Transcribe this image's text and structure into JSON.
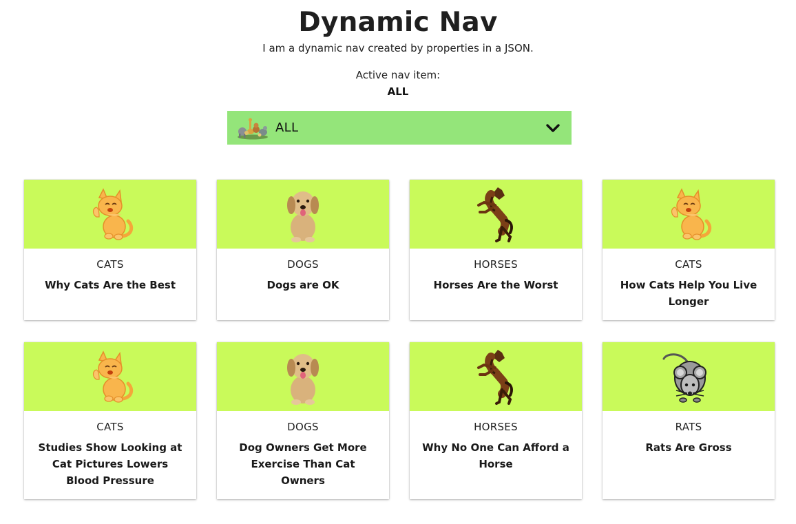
{
  "header": {
    "title": "Dynamic Nav",
    "subtitle": "I am a dynamic nav created by properties in a JSON.",
    "active_label": "Active nav item:",
    "active_value": "ALL"
  },
  "nav": {
    "selected": "ALL",
    "thumbnail_icon": "animals-group-icon",
    "chevron_icon": "chevron-down-icon",
    "background_color": "#94e57a"
  },
  "cards": [
    {
      "category": "CATS",
      "title": "Why Cats Are the Best",
      "icon": "cat-icon"
    },
    {
      "category": "DOGS",
      "title": "Dogs are OK",
      "icon": "dog-icon"
    },
    {
      "category": "HORSES",
      "title": "Horses Are the Worst",
      "icon": "horse-icon"
    },
    {
      "category": "CATS",
      "title": "How Cats Help You Live Longer",
      "icon": "cat-icon"
    },
    {
      "category": "CATS",
      "title": "Studies Show Looking at Cat Pictures Lowers Blood Pressure",
      "icon": "cat-icon"
    },
    {
      "category": "DOGS",
      "title": "Dog Owners Get More Exercise Than Cat Owners",
      "icon": "dog-icon"
    },
    {
      "category": "HORSES",
      "title": "Why No One Can Afford a Horse",
      "icon": "horse-icon"
    },
    {
      "category": "RATS",
      "title": "Rats Are Gross",
      "icon": "rat-icon"
    }
  ],
  "colors": {
    "card_image_bg": "#c9fa5a",
    "nav_bg": "#94e57a"
  }
}
